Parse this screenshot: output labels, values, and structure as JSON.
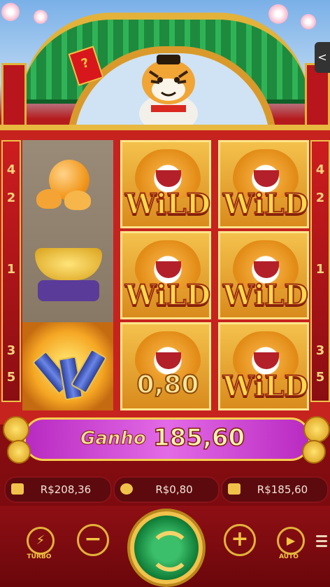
{
  "game": {
    "side_numbers_left": [
      "4",
      "2",
      "1",
      "3",
      "5"
    ],
    "side_numbers_right": [
      "4",
      "2",
      "1",
      "3",
      "5"
    ],
    "envelope_symbol": "?",
    "menu_tab_icon": "<"
  },
  "reels": {
    "left": [
      "orange-symbol",
      "gold-ingot-symbol",
      "firecracker-symbol"
    ],
    "mid": [
      {
        "type": "wild",
        "label": "WiLD"
      },
      {
        "type": "wild",
        "label": "WiLD"
      },
      {
        "type": "wild-win",
        "amount": "0,80"
      }
    ],
    "right": [
      {
        "type": "wild",
        "label": "WiLD"
      },
      {
        "type": "wild",
        "label": "WiLD"
      },
      {
        "type": "wild",
        "label": "WiLD"
      }
    ]
  },
  "win": {
    "label": "Ganho",
    "value": "185,60"
  },
  "info": {
    "balance": "R$208,36",
    "bet": "R$0,80",
    "last_win": "R$185,60"
  },
  "controls": {
    "turbo_label": "TURBO",
    "auto_label": "AUTO",
    "minus_symbol": "−",
    "plus_symbol": "+"
  },
  "colors": {
    "frame_red": "#c6231f",
    "gold": "#f0c24a",
    "win_purple": "#e36ae6",
    "spin_green": "#0e7a35"
  }
}
